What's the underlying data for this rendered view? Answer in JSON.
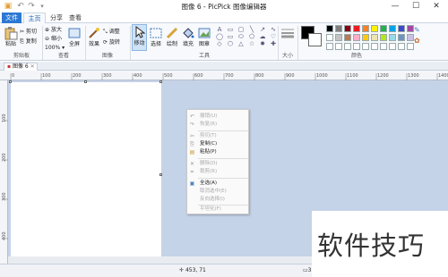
{
  "window": {
    "title": "图像 6 - PicPick 图像编辑器",
    "min": "—",
    "max": "☐",
    "close": "✕"
  },
  "quick_access": {
    "save_icon": "save-icon",
    "undo": "↶",
    "redo": "↷",
    "more": "▾"
  },
  "tabs": [
    {
      "label": "文件"
    },
    {
      "label": "主页"
    },
    {
      "label": "分享"
    },
    {
      "label": "查看"
    }
  ],
  "ribbon": {
    "clipboard": {
      "paste": "粘贴",
      "cut": "剪切",
      "copy": "复制",
      "group": "剪贴板"
    },
    "view": {
      "zoom_in": "放大",
      "zoom_out": "缩小",
      "zoom_level": "100%",
      "zoom_arrow": "▾",
      "fullscreen": "全屏",
      "group": "查看"
    },
    "image": {
      "effects": "效果",
      "resize": "调整",
      "rotate": "旋转",
      "group": "图像"
    },
    "tools": {
      "move": "移动",
      "select": "选择",
      "draw": "绘制",
      "fill": "填充",
      "image": "图章",
      "group": "工具"
    },
    "size": {
      "group": "大小"
    },
    "colors": {
      "group": "颜色",
      "swatches": [
        "#000000",
        "#7f7f7f",
        "#880015",
        "#ed1c24",
        "#ff7f27",
        "#fff200",
        "#22b14c",
        "#00a2e8",
        "#3f48cc",
        "#a349a4",
        "#ffffff",
        "#c3c3c3",
        "#b97a57",
        "#ffaec9",
        "#ffc90e",
        "#efe4b0",
        "#b5e61d",
        "#99d9ea",
        "#7092be",
        "#c8bfe7"
      ]
    }
  },
  "document_tab": {
    "label": "图像 6",
    "close": "✕"
  },
  "ruler": {
    "h_ticks": [
      "0",
      "100",
      "200",
      "300",
      "400",
      "500",
      "600",
      "700",
      "800",
      "900",
      "1000",
      "1100",
      "1200",
      "1300",
      "1400"
    ],
    "v_ticks": [
      "100",
      "200",
      "300",
      "400"
    ]
  },
  "context_menu": {
    "items": [
      {
        "label": "撤销(U)",
        "icon": "↶",
        "enabled": false
      },
      {
        "label": "恢复(R)",
        "icon": "↷",
        "enabled": false
      },
      {
        "label": "剪切(T)",
        "icon": "✂",
        "enabled": false
      },
      {
        "label": "复制(C)",
        "icon": "⎘",
        "enabled": true
      },
      {
        "label": "粘贴(P)",
        "icon": "▤",
        "enabled": true
      },
      {
        "label": "删除(D)",
        "icon": "✕",
        "enabled": false
      },
      {
        "label": "裁剪(R)",
        "icon": "⌗",
        "enabled": false
      },
      {
        "label": "全选(A)",
        "icon": "▣",
        "enabled": true
      },
      {
        "label": "取消选中(E)",
        "icon": "",
        "enabled": false
      },
      {
        "label": "反向选择(I)",
        "icon": "",
        "enabled": false
      },
      {
        "label": "平坦化(F)",
        "icon": "",
        "enabled": false
      }
    ]
  },
  "status": {
    "cursor_pos": "453, 71",
    "zoom": "100%",
    "size_label": "38"
  },
  "watermark": {
    "text": "软件技巧"
  }
}
